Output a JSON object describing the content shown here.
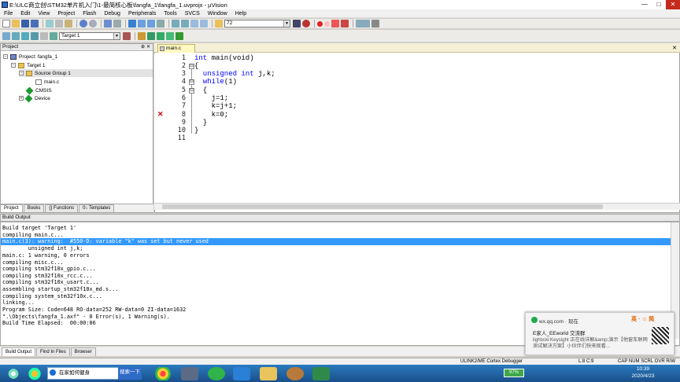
{
  "window": {
    "title": "E:\\ULC商立创\\STM32单片机入门\\1-最简核心板\\fangfa_1\\fangfa_1.uvprojx - µVision",
    "buttons": {
      "minimize": "—",
      "maximize": "□",
      "close": "✕"
    }
  },
  "menu": [
    "File",
    "Edit",
    "View",
    "Project",
    "Flash",
    "Debug",
    "Peripherals",
    "Tools",
    "SVCS",
    "Window",
    "Help"
  ],
  "toolbar": {
    "find_value": "72",
    "target_value": "Target 1"
  },
  "project_panel": {
    "header": "Project",
    "pin": "⊕",
    "close": "✕",
    "tree": [
      {
        "label": "Project: fangfa_1",
        "expander": "−"
      },
      {
        "label": "Target 1",
        "expander": "−"
      },
      {
        "label": "Source Group 1",
        "expander": "−"
      },
      {
        "label": "main.c",
        "expander": ""
      },
      {
        "label": "CMSIS",
        "expander": ""
      },
      {
        "label": "Device",
        "expander": "+"
      }
    ],
    "tabs": [
      "Project",
      "Books",
      "{} Functions",
      "0↓ Templates"
    ]
  },
  "editor": {
    "tab": "main.c",
    "line_numbers": [
      "1",
      "2",
      "3",
      "4",
      "5",
      "6",
      "7",
      "8",
      "9",
      "10",
      "11"
    ],
    "fold_markers": [
      "⊟",
      "⊟",
      "⊟"
    ],
    "lines": [
      {
        "kw": "int",
        "rest": " main(void)"
      },
      {
        "kw": "",
        "rest": "{"
      },
      {
        "kw": "  unsigned int",
        "rest": " j,k;"
      },
      {
        "kw": "  while",
        "rest": "(1)"
      },
      {
        "kw": "",
        "rest": "  {"
      },
      {
        "kw": "",
        "rest": "    j=1;"
      },
      {
        "kw": "",
        "rest": "    k=j+1;"
      },
      {
        "kw": "",
        "rest": "    k=0;"
      },
      {
        "kw": "",
        "rest": "  }"
      },
      {
        "kw": "",
        "rest": "}"
      },
      {
        "kw": "",
        "rest": ""
      }
    ],
    "error_marker": "✕"
  },
  "build_output": {
    "header": "Build Output",
    "lines": [
      "Build target 'Target 1'",
      "compiling main.c...",
      "main.c(3): warning:  #550-D: variable \"k\" was set but never used",
      "        unsigned int j,k;",
      "main.c: 1 warning, 0 errors",
      "compiling misc.c...",
      "compiling stm32f10x_gpio.c...",
      "compiling stm32f10x_rcc.c...",
      "compiling stm32f10x_usart.c...",
      "assembling startup_stm32f10x_md.s...",
      "compiling system_stm32f10x.c...",
      "linking...",
      "Program Size: Code=648 RO-data=252 RW-data=0 ZI-data=1632",
      "\".\\Objects\\fangfa_1.axf\" - 0 Error(s), 1 Warning(s).",
      "Build Time Elapsed:  00:00:06"
    ],
    "tabs": [
      "Build Output",
      "Find In Files",
      "Browser"
    ]
  },
  "status_bar": {
    "debugger": "ULINK2/ME Cortex Debugger",
    "position": "L:8 C:9",
    "flags": "CAP  NUM  SCRL  OVR  R/W"
  },
  "notification": {
    "source": "wx.qq.com · 现在",
    "title": "E家人_EEworld 交流群",
    "body": "lightxixi:Keysight 正在线详解&amp;演示【他窗车联网测试解决方案】小伙伴们快来观看...",
    "tray": "英 · ☺ 简"
  },
  "taskbar": {
    "search_placeholder": "在家如何健身",
    "search_button": "搜索一下",
    "battery": "97%",
    "time": "10:39",
    "date": "2020/4/23"
  }
}
